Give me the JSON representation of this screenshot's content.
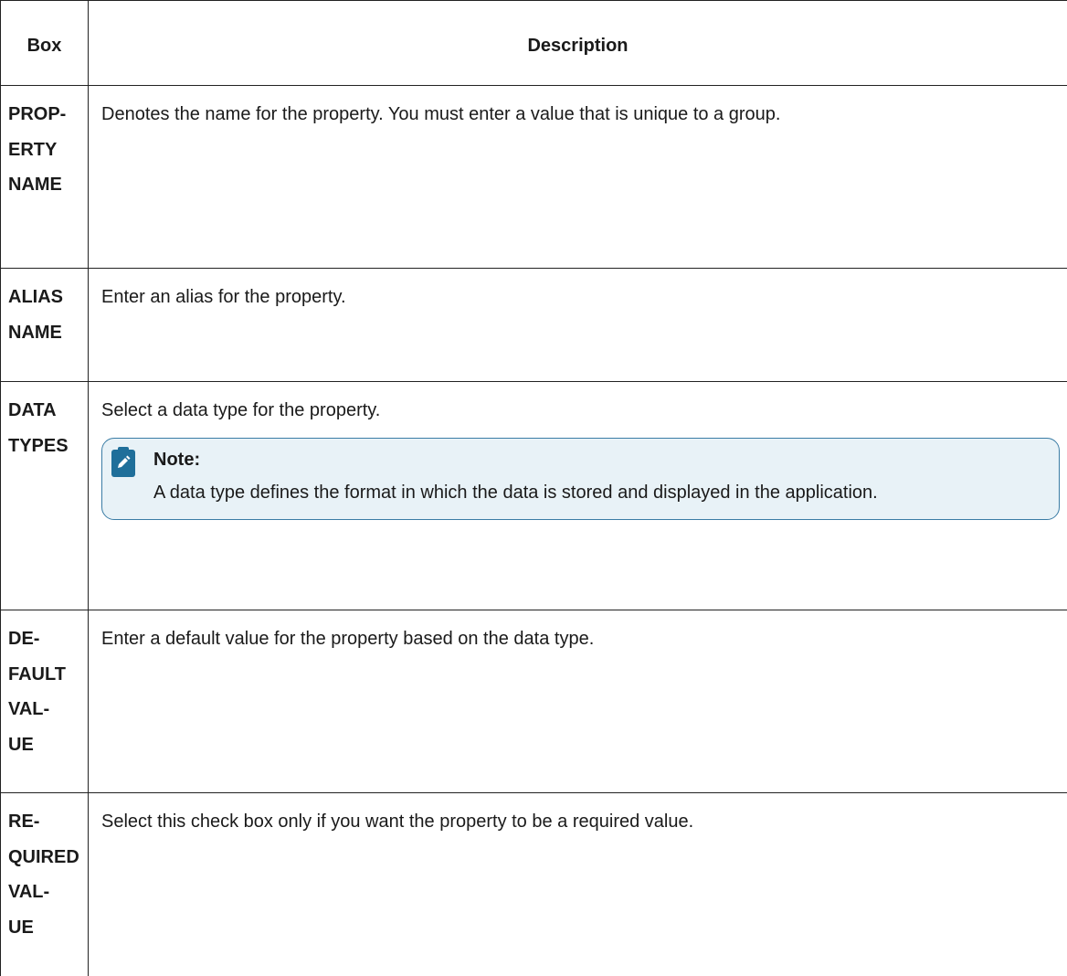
{
  "headers": {
    "box": "Box",
    "description": "Description"
  },
  "rows": [
    {
      "box": "PROP-\nERTY\nNAME",
      "description": "Denotes the name for the property. You must enter a value that is unique to a group."
    },
    {
      "box": "ALIAS\nNAME",
      "description": "Enter an alias for the property."
    },
    {
      "box": "DATA\nTYPES",
      "description": "Select a data type for the property.",
      "note": {
        "title": "Note:",
        "text": "A data type defines the format in which the data is stored and displayed in the application.",
        "icon": "pencil-note-icon"
      }
    },
    {
      "box": "DE-\nFAULT\nVAL-\nUE",
      "description": "Enter a default value for the property based on the data type."
    },
    {
      "box": "RE-\nQUIRED\nVAL-\nUE",
      "description": "Select this check box only if you want the property to be a required value."
    }
  ],
  "colors": {
    "border": "#222222",
    "note_border": "#3a7ca5",
    "note_background": "#e8f2f7",
    "note_icon": "#1f6f9a"
  }
}
